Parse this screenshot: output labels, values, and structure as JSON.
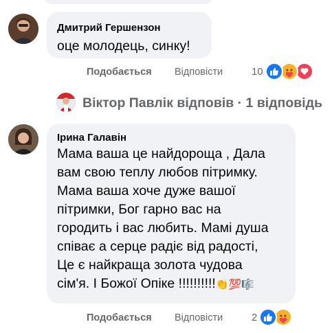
{
  "comment1": {
    "author": "Дмитрий Гершензон",
    "text": "оце молодець, синку!",
    "actions": {
      "like": "Подобається",
      "reply": "Відповісти"
    },
    "reaction_count": "10",
    "reactions": [
      "like-icon",
      "care-icon",
      "love-icon"
    ]
  },
  "replies_link": {
    "author": "Віктор Павлік",
    "text": "Віктор Павлік відповів · 1 відповідь"
  },
  "comment2": {
    "author": "Ірина Галавін",
    "text_lines": [
      "Мама ваша це найдороща , Дала",
      "вам свою теплу любов пітримку.",
      "Мама ваша хоче дуже вашої",
      "пітримки, Бог гарно вас на",
      "городить і вас любить. Мамі душа",
      "співає а серце радіє від радості,",
      "Це є найкраща золота чудова",
      "сім'я. І Божої Опіке !!!!!!!!!!"
    ],
    "emojis": [
      "clapping-hands-emoji",
      "hundred-points-emoji",
      "musical-score-emoji"
    ],
    "emoji_glyphs": [
      "👏",
      "💯",
      "🎼"
    ],
    "actions": {
      "like": "Подобається",
      "reply": "Відповісти"
    },
    "reaction_count": "2",
    "reactions": [
      "like-icon",
      "care-icon"
    ]
  },
  "colors": {
    "bubble": "#f0f2f5",
    "secondary_text": "#65676b",
    "like_blue": "#1877f2",
    "love_red": "#f33e58",
    "care_yellow": "#f7b125"
  }
}
